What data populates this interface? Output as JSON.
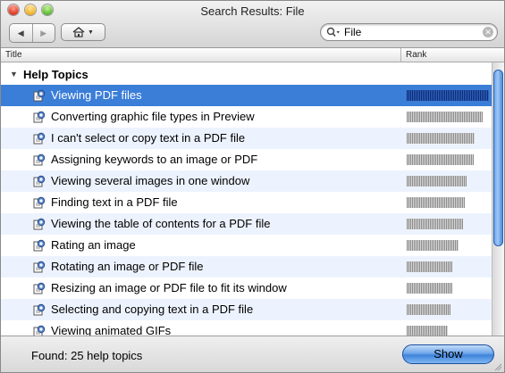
{
  "window": {
    "title": "Search Results: File"
  },
  "toolbar": {
    "back_icon": "back-arrow-icon",
    "forward_icon": "forward-arrow-icon",
    "home_icon": "home-icon"
  },
  "search": {
    "value": "File",
    "icon": "magnifier-icon"
  },
  "table": {
    "col_title": "Title",
    "col_rank": "Rank",
    "group": "Help Topics",
    "rows": [
      {
        "label": "Viewing PDF files",
        "rank": 1.0,
        "selected": true
      },
      {
        "label": "Converting graphic file types in Preview",
        "rank": 0.92
      },
      {
        "label": "I can't select or copy text in a PDF file",
        "rank": 0.83
      },
      {
        "label": "Assigning keywords to an image or PDF",
        "rank": 0.81
      },
      {
        "label": "Viewing several images in one window",
        "rank": 0.73
      },
      {
        "label": "Finding text in a PDF file",
        "rank": 0.71
      },
      {
        "label": "Viewing the table of contents for a PDF file",
        "rank": 0.69
      },
      {
        "label": "Rating an image",
        "rank": 0.63
      },
      {
        "label": "Rotating an image or PDF file",
        "rank": 0.55
      },
      {
        "label": "Resizing an image or PDF file to fit its window",
        "rank": 0.55
      },
      {
        "label": "Selecting and copying text in a PDF file",
        "rank": 0.53
      },
      {
        "label": "Viewing animated GIFs",
        "rank": 0.5
      }
    ]
  },
  "footer": {
    "found_text": "Found: 25 help topics",
    "show_label": "Show"
  },
  "colors": {
    "selection": "#3b7ed8",
    "alt_row": "#edf3fe",
    "accent_button": "#6ea6ea"
  }
}
